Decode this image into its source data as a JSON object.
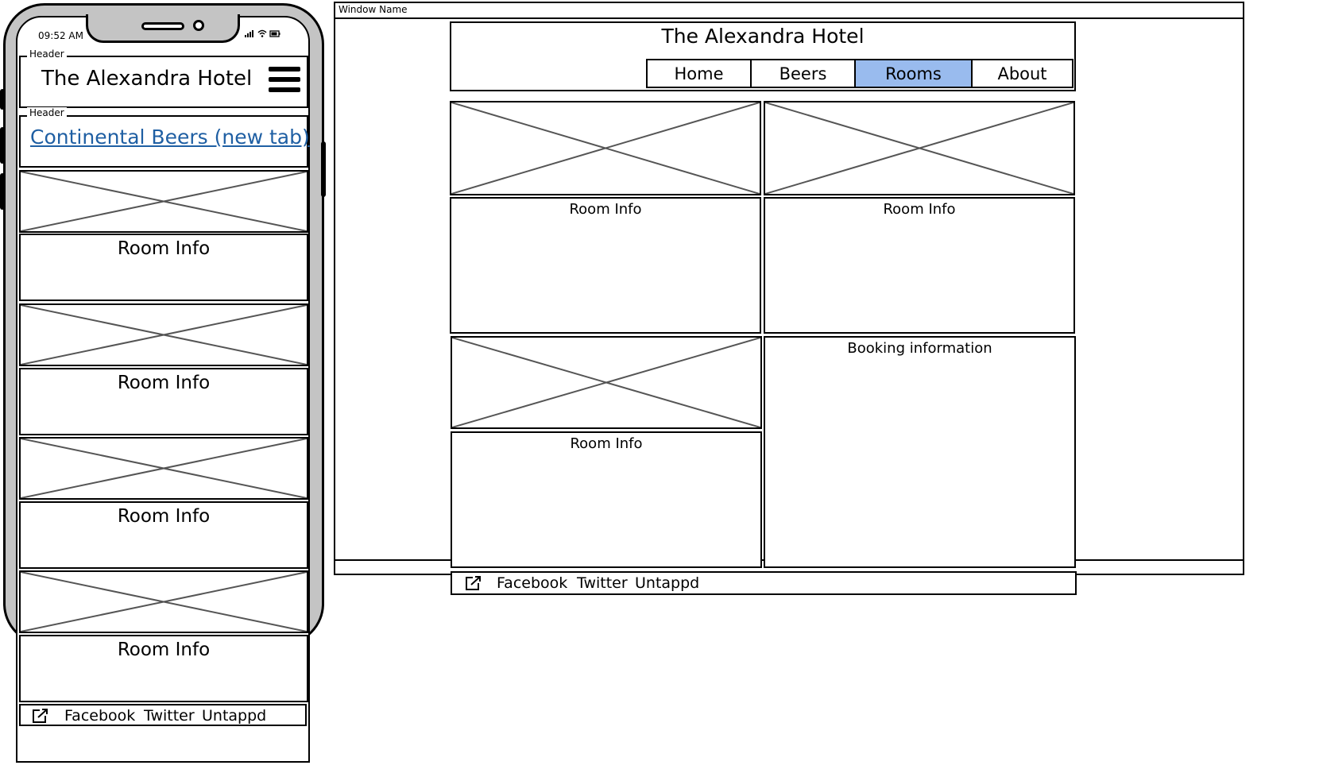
{
  "phone": {
    "status_time": "09:52 AM",
    "header_label": "Header",
    "title": "The Alexandra Hotel",
    "link_header_label": "Header",
    "link_text": "Continental Beers (new tab)",
    "room_label": "Room Info",
    "footer": {
      "links": [
        "Facebook",
        "Twitter",
        "Untappd"
      ]
    }
  },
  "desktop": {
    "window_name": "Window Name",
    "title": "The Alexandra Hotel",
    "nav": {
      "items": [
        "Home",
        "Beers",
        "Rooms",
        "About"
      ],
      "active": "Rooms",
      "active_color": "#99bbee"
    },
    "room_label": "Room Info",
    "booking_label": "Booking information",
    "footer": {
      "links": [
        "Facebook",
        "Twitter",
        "Untappd"
      ]
    }
  },
  "icons": {
    "menu": "hamburger-menu-icon",
    "external_link": "external-link-icon",
    "image_placeholder": "image-placeholder-icon"
  }
}
